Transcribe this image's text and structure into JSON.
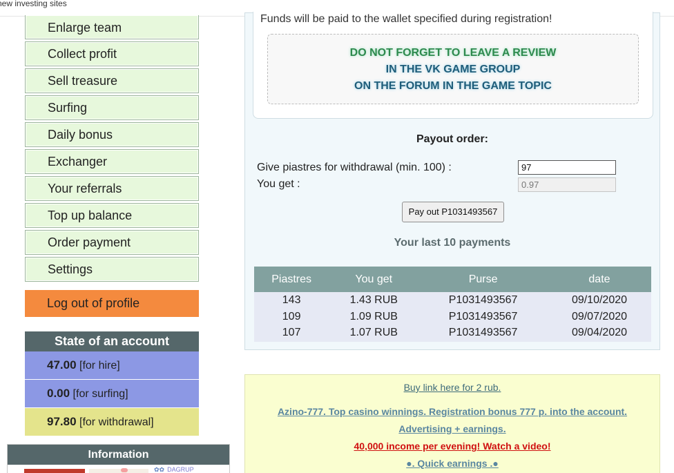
{
  "header": {
    "site_title": "new investing sites"
  },
  "menu": {
    "items": [
      {
        "label": "Enlarge team"
      },
      {
        "label": "Collect profit"
      },
      {
        "label": "Sell treasure"
      },
      {
        "label": "Surfing"
      },
      {
        "label": "Daily bonus"
      },
      {
        "label": "Exchanger"
      },
      {
        "label": "Your referrals"
      },
      {
        "label": "Top up balance"
      },
      {
        "label": "Order payment"
      },
      {
        "label": "Settings"
      }
    ],
    "logout": "Log out of profile"
  },
  "account": {
    "title": "State of an account",
    "hire_value": "47.00",
    "hire_label": "[for hire]",
    "surf_value": "0.00",
    "surf_label": "[for surfing]",
    "withdraw_value": "97.80",
    "withdraw_label": "[for withdrawal]"
  },
  "information": {
    "title": "Information",
    "banner_text": "DAGRUP"
  },
  "notice": {
    "funds_text": "Funds will be paid to the wallet specified during registration!",
    "line1": "DO NOT FORGET TO LEAVE A REVIEW",
    "line2": "IN THE VK GAME GROUP",
    "line3": "ON THE FORUM IN THE GAME TOPIC"
  },
  "payout": {
    "title": "Payout order:",
    "give_label": "Give piastres for withdrawal (min. 100) :",
    "give_value": "97",
    "get_label": "You get :",
    "get_value": "0.97",
    "button": "Pay out P1031493567",
    "last_title": "Your last 10 payments"
  },
  "payments_table": {
    "headers": [
      "Piastres",
      "You get",
      "Purse",
      "date"
    ],
    "rows": [
      [
        "143",
        "1.43 RUB",
        "P1031493567",
        "09/10/2020"
      ],
      [
        "109",
        "1.09 RUB",
        "P1031493567",
        "09/07/2020"
      ],
      [
        "107",
        "1.07 RUB",
        "P1031493567",
        "09/04/2020"
      ]
    ]
  },
  "ads": {
    "buy_link": "Buy link here for 2 rub.",
    "ad1": "Azino-777. Top casino winnings. Registration bonus 777 p. into the account.",
    "ad2": "Advertising + earnings.",
    "ad3": "40,000 income per evening! Watch a video!",
    "ad4": "●. Quick earnings .●"
  }
}
